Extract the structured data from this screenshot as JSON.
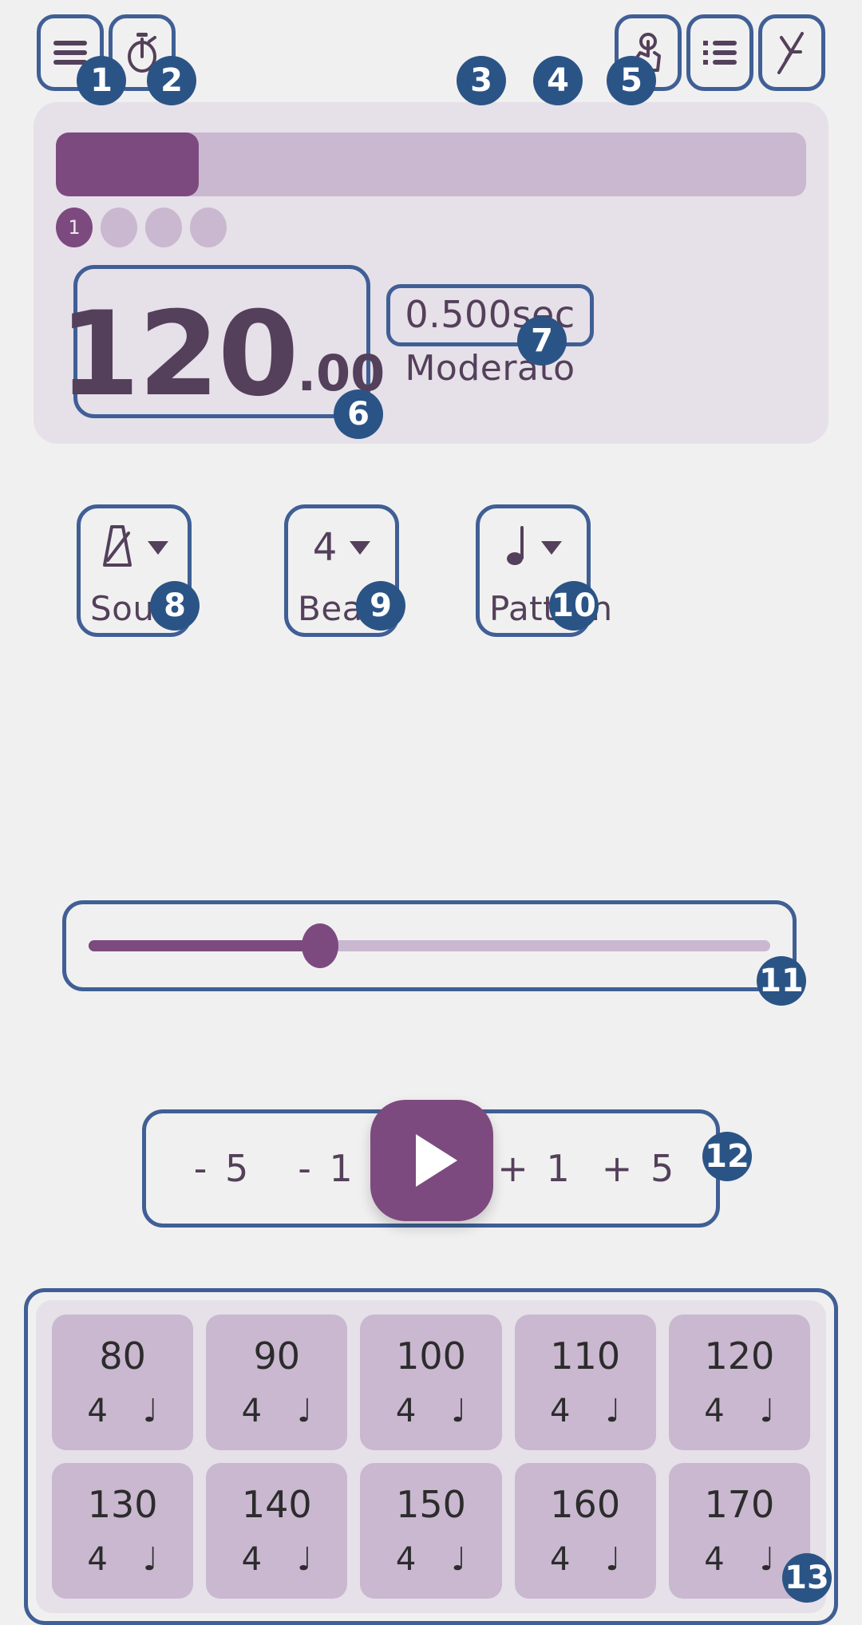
{
  "app": {
    "name": "Metronome",
    "accent_purple": "#7d4a7f",
    "accent_blue": "#3f5f95",
    "panel_bg": "#e6e0e9",
    "page_bg": "#f1f0f0",
    "text_dark": "#54405a"
  },
  "toolbar": {
    "left": [
      {
        "badge": "1",
        "icon": "hamburger-menu-icon",
        "name": "menu-button"
      },
      {
        "badge": "2",
        "icon": "stopwatch-timer-icon",
        "name": "timer-button"
      }
    ],
    "right": [
      {
        "badge": "3",
        "icon": "tap-tempo-hand-icon",
        "name": "tap-tempo-button"
      },
      {
        "badge": "4",
        "icon": "setlist-list-icon",
        "name": "setlist-button"
      },
      {
        "badge": "5",
        "icon": "tuning-fork-icon",
        "name": "tuner-button"
      }
    ]
  },
  "display": {
    "progress_percent": 19,
    "beat_dots": [
      {
        "label": "1",
        "active": true
      },
      {
        "label": "",
        "active": false
      },
      {
        "label": "",
        "active": false
      },
      {
        "label": "",
        "active": false
      }
    ],
    "bpm_integer": "120",
    "bpm_decimal": ".00",
    "interval": "0.500sec",
    "tempo_name": "Moderato",
    "badge_bpm": "6",
    "badge_tempo": "7"
  },
  "selectors": [
    {
      "value": "",
      "icon": "metronome-icon",
      "label": "Sound",
      "badge": "8",
      "name": "sound-selector"
    },
    {
      "value": "4",
      "icon": "",
      "label": "Beat",
      "badge": "9",
      "name": "beat-selector"
    },
    {
      "value": "",
      "icon": "quarter-note-icon",
      "label": "Pattern",
      "badge": "10",
      "name": "pattern-selector"
    }
  ],
  "slider": {
    "value_percent": 34,
    "badge": "11"
  },
  "transport": {
    "minus_five": "- 5",
    "minus_one": "- 1",
    "plus_one": "+ 1",
    "plus_five": "+ 5",
    "play_icon": "play-triangle-icon",
    "badge": "12"
  },
  "presets": {
    "badge": "13",
    "items": [
      {
        "bpm": "80",
        "beat": "4",
        "note": "♩"
      },
      {
        "bpm": "90",
        "beat": "4",
        "note": "♩"
      },
      {
        "bpm": "100",
        "beat": "4",
        "note": "♩"
      },
      {
        "bpm": "110",
        "beat": "4",
        "note": "♩"
      },
      {
        "bpm": "120",
        "beat": "4",
        "note": "♩"
      },
      {
        "bpm": "130",
        "beat": "4",
        "note": "♩"
      },
      {
        "bpm": "140",
        "beat": "4",
        "note": "♩"
      },
      {
        "bpm": "150",
        "beat": "4",
        "note": "♩"
      },
      {
        "bpm": "160",
        "beat": "4",
        "note": "♩"
      },
      {
        "bpm": "170",
        "beat": "4",
        "note": "♩"
      }
    ]
  }
}
